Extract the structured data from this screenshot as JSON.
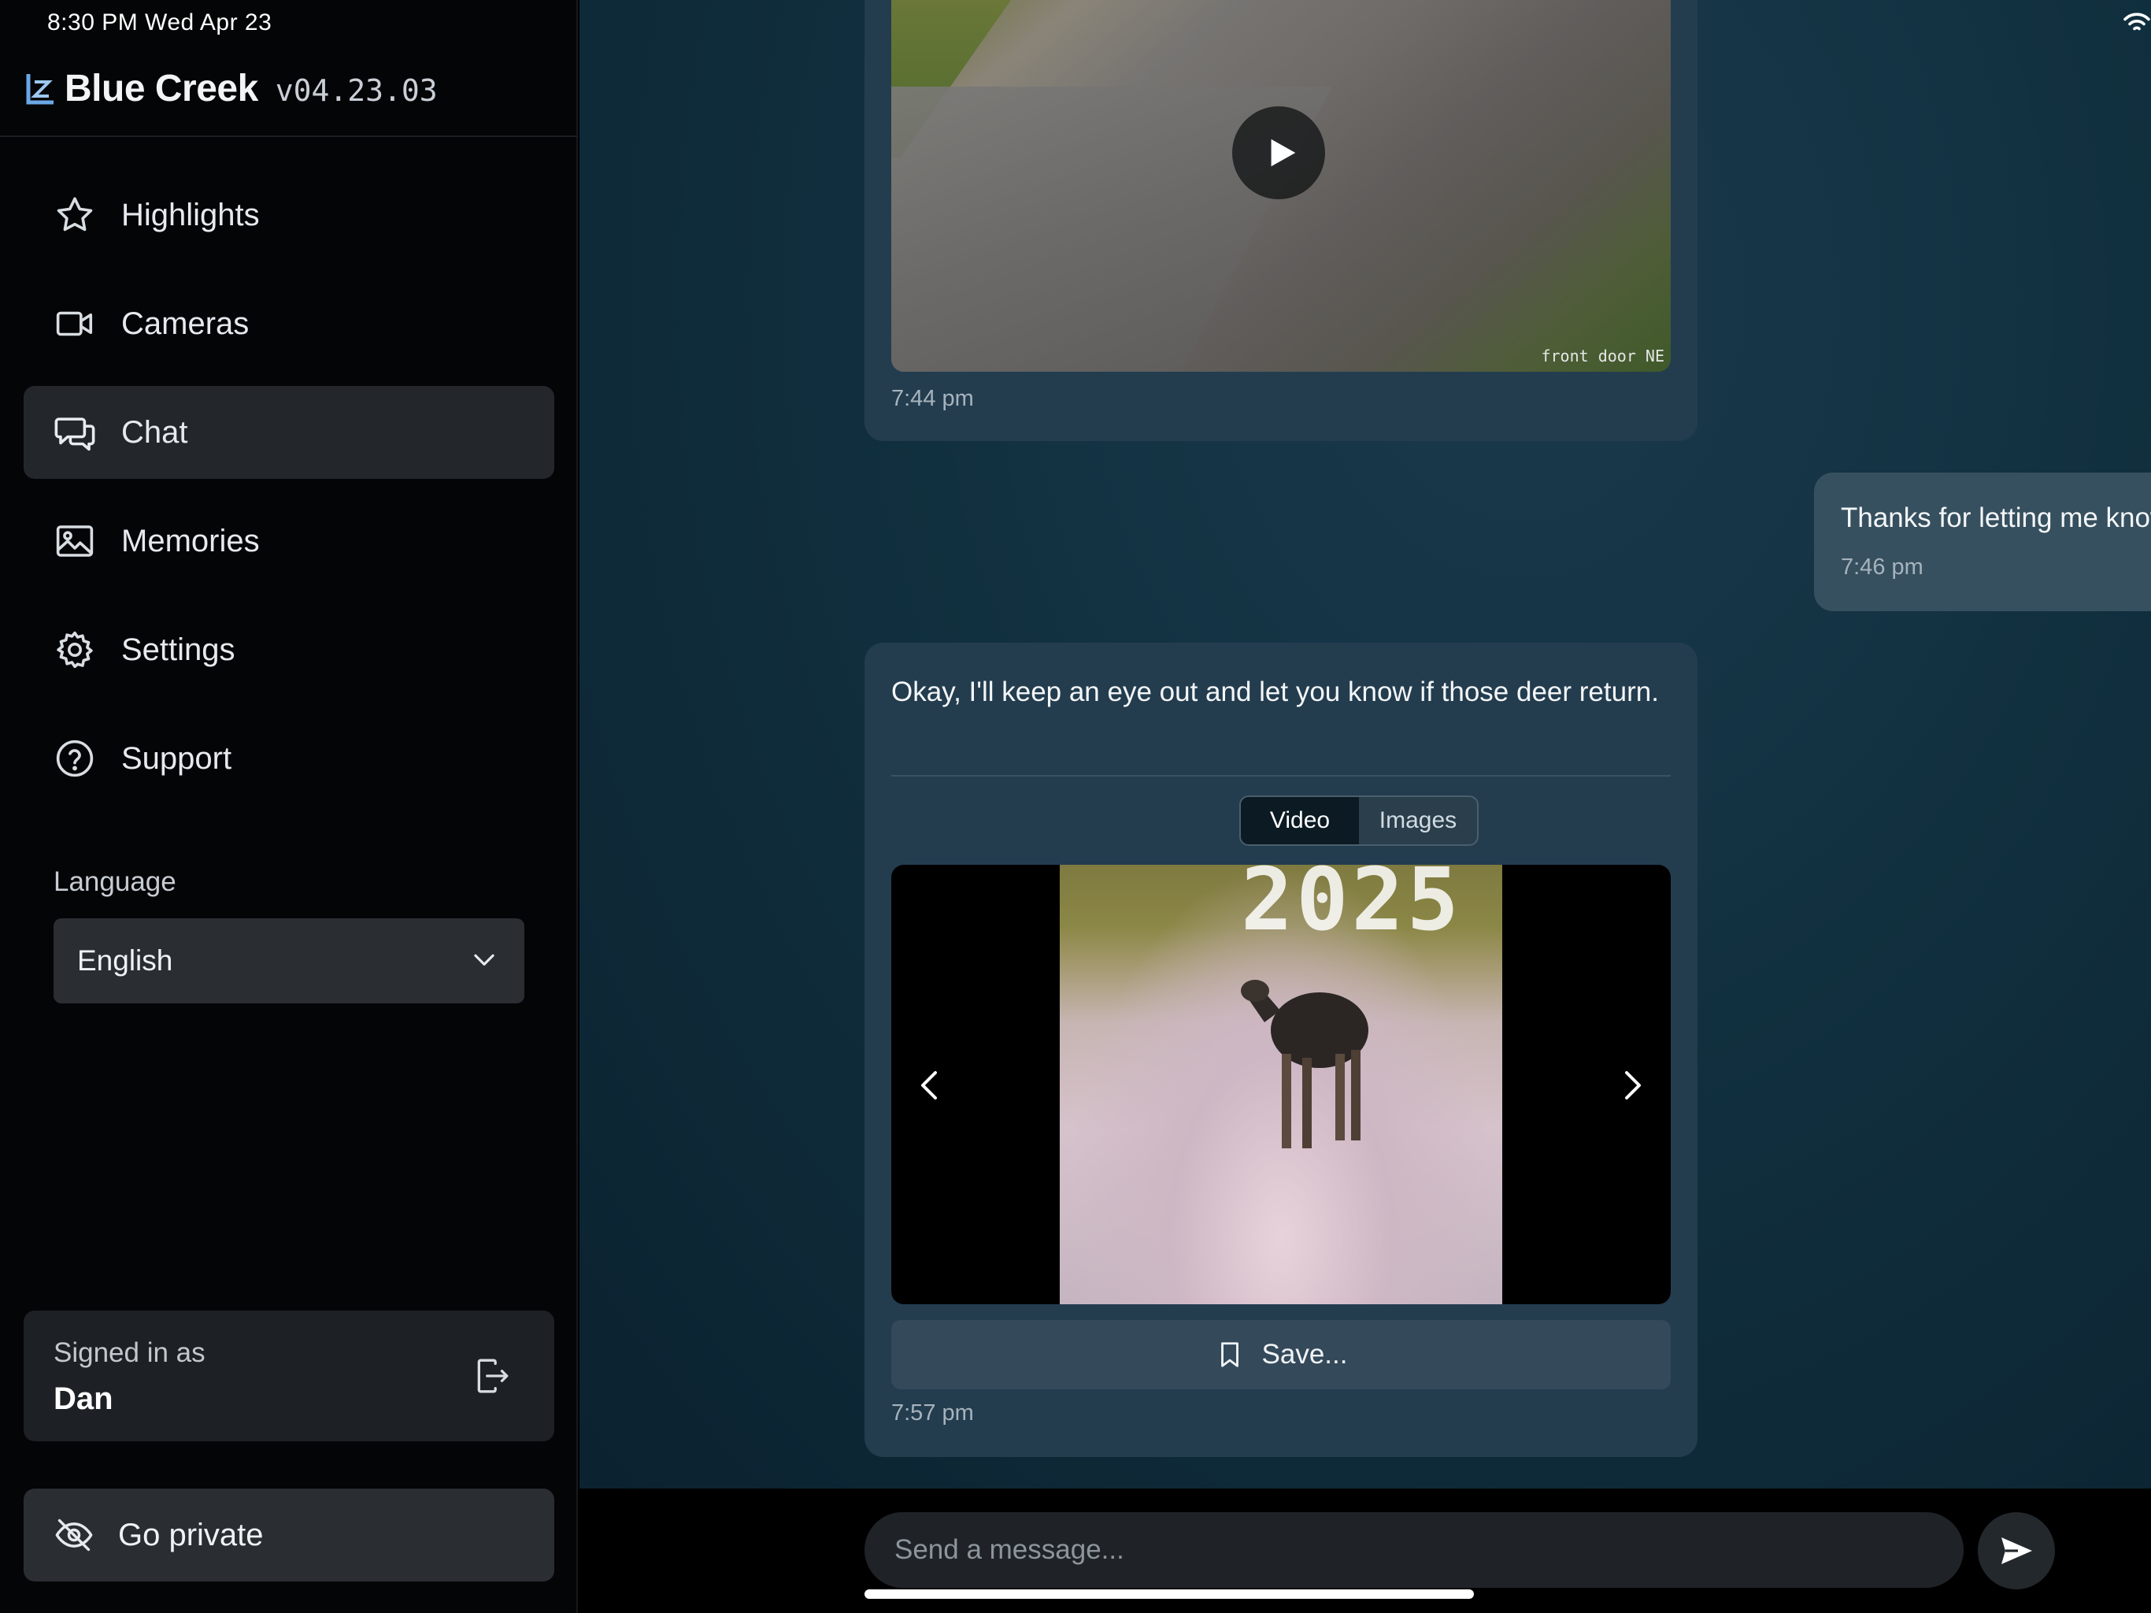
{
  "status_bar": {
    "time": "8:30 PM   Wed Apr 23"
  },
  "brand": {
    "name": "Blue Creek",
    "version": "v04.23.03"
  },
  "sidebar": {
    "nav": [
      {
        "label": "Highlights",
        "icon": "star-icon"
      },
      {
        "label": "Cameras",
        "icon": "video-camera-icon"
      },
      {
        "label": "Chat",
        "icon": "chat-bubbles-icon",
        "active": true
      },
      {
        "label": "Memories",
        "icon": "image-icon"
      },
      {
        "label": "Settings",
        "icon": "gear-icon"
      },
      {
        "label": "Support",
        "icon": "help-circle-icon"
      }
    ],
    "language": {
      "label": "Language",
      "value": "English"
    },
    "account": {
      "signed_in_label": "Signed in as",
      "user": "Dan"
    },
    "private_button": "Go private"
  },
  "chat": {
    "messages": [
      {
        "from": "assistant",
        "camera_label": "front door NE",
        "time": "7:44 pm"
      },
      {
        "from": "user",
        "text": "Thanks for letting me know. Let me know if they come back.",
        "time": "7:46 pm"
      },
      {
        "from": "assistant",
        "text": "Okay, I'll keep an eye out and let you know if those deer return.",
        "tabs": [
          "Video",
          "Images"
        ],
        "active_tab": "Video",
        "image_stamp": "2025",
        "save_label": "Save...",
        "time": "7:57 pm"
      }
    ]
  },
  "composer": {
    "placeholder": "Send a message..."
  },
  "colors": {
    "sidebar_bg": "#040506",
    "active_nav_bg": "#23272c",
    "bot_bubble": "#233d4f",
    "user_bubble": "#36505f"
  }
}
